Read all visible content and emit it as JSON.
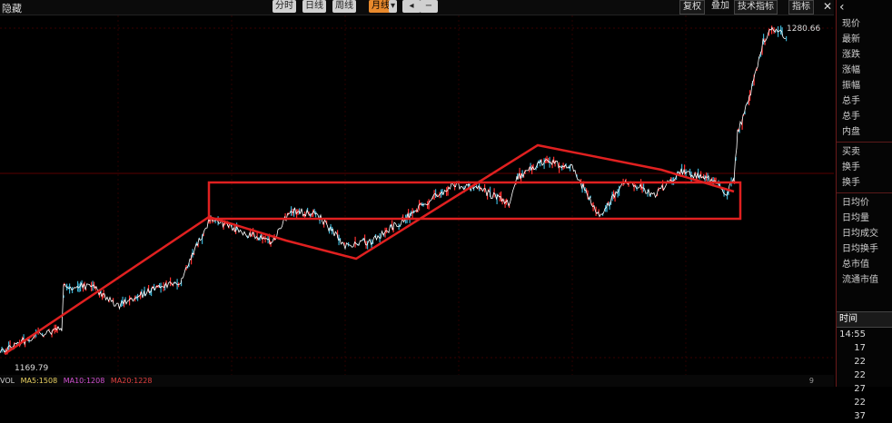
{
  "title": "隐藏",
  "toolbar": {
    "periods": [
      "分时",
      "日线",
      "周线",
      "月线"
    ],
    "active_period_index": 3,
    "icon_buttons": [
      "◂",
      "−"
    ],
    "right_buttons": [
      "复权",
      "叠加",
      "技术指标",
      "指标"
    ]
  },
  "chart": {
    "price_label_high": "1280.66",
    "price_label_low": "1169.79",
    "accent_color": "#e02020",
    "line_color": "#ffffff",
    "bar_up_color": "#ff3030",
    "bar_down_color": "#3ab0d0"
  },
  "bottombar": {
    "indicators": [
      {
        "text": "VOL",
        "color": "#cfcfcf"
      },
      {
        "text": "MA5:1508",
        "color": "#e8d060"
      },
      {
        "text": "MA10:1208",
        "color": "#d050d0"
      },
      {
        "text": "MA20:1228",
        "color": "#e04040"
      }
    ],
    "right_text": "9"
  },
  "sidebar": {
    "items_top": [
      "现价",
      "最新",
      "涨跌",
      "涨幅",
      "振幅",
      "总手",
      "总手",
      "内盘"
    ],
    "items_mid": [
      "买卖",
      "换手",
      "换手"
    ],
    "items_bottom": [
      "日均价",
      "日均量",
      "日均成交",
      "日均换手",
      "总市值",
      "流通市值"
    ],
    "time_header": "时间",
    "times": [
      "14:55",
      "17",
      "22",
      "22",
      "27",
      "22",
      "37"
    ]
  }
}
